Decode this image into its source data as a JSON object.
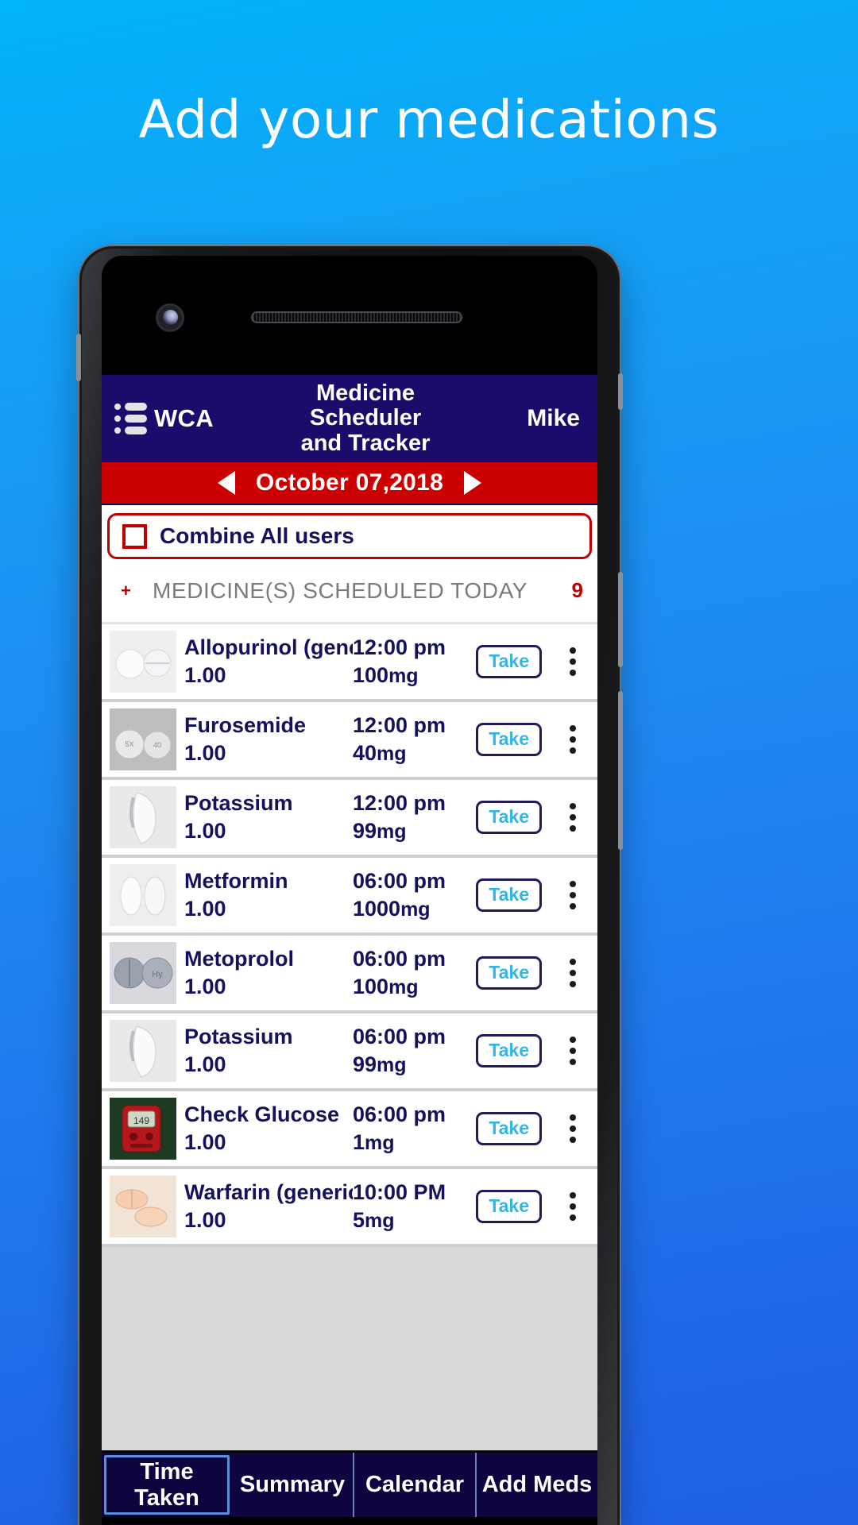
{
  "promo": {
    "headline": "Add your medications"
  },
  "app": {
    "brand": "WCA",
    "title": "Medicine\nScheduler\nand Tracker",
    "title_lines": [
      "Medicine",
      "Scheduler",
      "and Tracker"
    ],
    "user": "Mike",
    "date": "October 07,2018",
    "prev_label": "◀",
    "next_label": "▶",
    "combine": {
      "label": "Combine All users",
      "checked": false
    },
    "section": {
      "add_label": "+",
      "title": "MEDICINE(S) SCHEDULED TODAY",
      "count": "9"
    },
    "take_label": "Take",
    "medicines": [
      {
        "name": "Allopurinol (gener...",
        "qty": "1.00",
        "time": "12:00 pm",
        "dose": "100",
        "unit": "mg",
        "pill": "two-round-white"
      },
      {
        "name": "Furosemide",
        "qty": "1.00",
        "time": "12:00 pm",
        "dose": "40",
        "unit": "mg",
        "pill": "two-round-marked"
      },
      {
        "name": "Potassium",
        "qty": "1.00",
        "time": "12:00 pm",
        "dose": "99",
        "unit": "mg",
        "pill": "capsule-white"
      },
      {
        "name": "Metformin",
        "qty": "1.00",
        "time": "06:00 pm",
        "dose": "1000",
        "unit": "mg",
        "pill": "two-oval-white"
      },
      {
        "name": "Metoprolol",
        "qty": "1.00",
        "time": "06:00 pm",
        "dose": "100",
        "unit": "mg",
        "pill": "two-round-blue"
      },
      {
        "name": "Potassium",
        "qty": "1.00",
        "time": "06:00 pm",
        "dose": "99",
        "unit": "mg",
        "pill": "capsule-white"
      },
      {
        "name": "Check Glucose",
        "qty": "1.00",
        "time": "06:00 pm",
        "dose": "1",
        "unit": "mg",
        "pill": "glucometer"
      },
      {
        "name": "Warfarin (generic...",
        "qty": "1.00",
        "time": "10:00 PM",
        "dose": "5",
        "unit": "mg",
        "pill": "two-oval-peach"
      }
    ],
    "tabs": [
      {
        "label": "Time\nTaken",
        "lines": [
          "Time",
          "Taken"
        ],
        "active": true
      },
      {
        "label": "Summary",
        "lines": [
          "Summary"
        ],
        "active": false
      },
      {
        "label": "Calendar",
        "lines": [
          "Calendar"
        ],
        "active": false
      },
      {
        "label": "Add Meds",
        "lines": [
          "Add Meds"
        ],
        "active": false
      }
    ]
  },
  "colors": {
    "header_navy": "#1c0b6b",
    "date_red": "#cc0000",
    "accent_cyan": "#33b5e5",
    "text_navy": "#14125c",
    "tab_navy": "#0d0440",
    "bg_blue_top": "#00b4fb",
    "bg_blue_bottom": "#1f5fe4"
  }
}
